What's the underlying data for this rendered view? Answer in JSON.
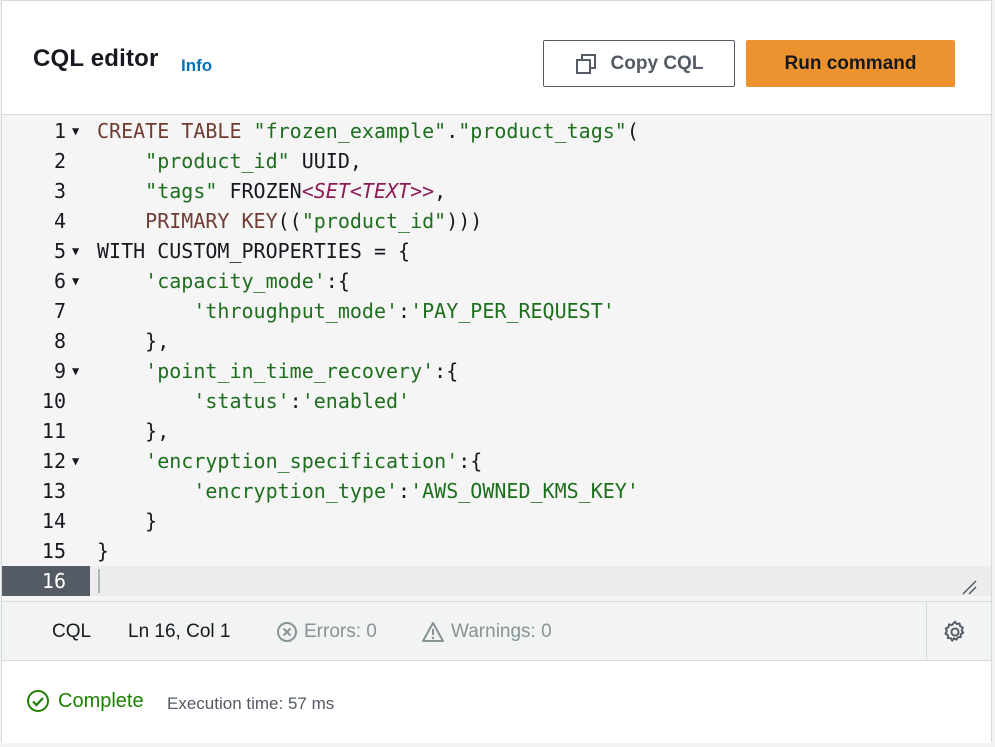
{
  "header": {
    "title": "CQL editor",
    "info_link": "Info",
    "copy_button": "Copy CQL",
    "run_button": "Run command"
  },
  "editor": {
    "active_line": 16,
    "fold_lines": [
      1,
      5,
      6,
      9,
      12
    ],
    "lines": [
      {
        "n": "1",
        "segments": [
          {
            "t": "CREATE TABLE ",
            "c": "kw"
          },
          {
            "t": "\"frozen_example\"",
            "c": "str"
          },
          {
            "t": ".",
            "c": ""
          },
          {
            "t": "\"product_tags\"",
            "c": "str"
          },
          {
            "t": "(",
            "c": ""
          }
        ]
      },
      {
        "n": "2",
        "segments": [
          {
            "t": "    ",
            "c": ""
          },
          {
            "t": "\"product_id\"",
            "c": "str"
          },
          {
            "t": " UUID,",
            "c": ""
          }
        ]
      },
      {
        "n": "3",
        "segments": [
          {
            "t": "    ",
            "c": ""
          },
          {
            "t": "\"tags\"",
            "c": "str"
          },
          {
            "t": " FROZEN",
            "c": ""
          },
          {
            "t": "<SET<TEXT>>",
            "c": "typ"
          },
          {
            "t": ",",
            "c": ""
          }
        ]
      },
      {
        "n": "4",
        "segments": [
          {
            "t": "    ",
            "c": ""
          },
          {
            "t": "PRIMARY KEY",
            "c": "kw"
          },
          {
            "t": "((",
            "c": ""
          },
          {
            "t": "\"product_id\"",
            "c": "str"
          },
          {
            "t": ")))",
            "c": ""
          }
        ]
      },
      {
        "n": "5",
        "segments": [
          {
            "t": "WITH CUSTOM_PROPERTIES = {",
            "c": ""
          }
        ]
      },
      {
        "n": "6",
        "segments": [
          {
            "t": "    ",
            "c": ""
          },
          {
            "t": "'capacity_mode'",
            "c": "str"
          },
          {
            "t": ":{",
            "c": ""
          }
        ]
      },
      {
        "n": "7",
        "segments": [
          {
            "t": "        ",
            "c": ""
          },
          {
            "t": "'throughput_mode'",
            "c": "str"
          },
          {
            "t": ":",
            "c": ""
          },
          {
            "t": "'PAY_PER_REQUEST'",
            "c": "str"
          }
        ]
      },
      {
        "n": "8",
        "segments": [
          {
            "t": "    },",
            "c": ""
          }
        ]
      },
      {
        "n": "9",
        "segments": [
          {
            "t": "    ",
            "c": ""
          },
          {
            "t": "'point_in_time_recovery'",
            "c": "str"
          },
          {
            "t": ":{",
            "c": ""
          }
        ]
      },
      {
        "n": "10",
        "segments": [
          {
            "t": "        ",
            "c": ""
          },
          {
            "t": "'status'",
            "c": "str"
          },
          {
            "t": ":",
            "c": ""
          },
          {
            "t": "'enabled'",
            "c": "str"
          }
        ]
      },
      {
        "n": "11",
        "segments": [
          {
            "t": "    },",
            "c": ""
          }
        ]
      },
      {
        "n": "12",
        "segments": [
          {
            "t": "    ",
            "c": ""
          },
          {
            "t": "'encryption_specification'",
            "c": "str"
          },
          {
            "t": ":{",
            "c": ""
          }
        ]
      },
      {
        "n": "13",
        "segments": [
          {
            "t": "        ",
            "c": ""
          },
          {
            "t": "'encryption_type'",
            "c": "str"
          },
          {
            "t": ":",
            "c": ""
          },
          {
            "t": "'AWS_OWNED_KMS_KEY'",
            "c": "str"
          }
        ]
      },
      {
        "n": "14",
        "segments": [
          {
            "t": "    }",
            "c": ""
          }
        ]
      },
      {
        "n": "15",
        "segments": [
          {
            "t": "}",
            "c": ""
          }
        ]
      },
      {
        "n": "16",
        "segments": []
      }
    ]
  },
  "status_bar": {
    "language": "CQL",
    "position": "Ln 16, Col 1",
    "errors": "Errors: 0",
    "warnings": "Warnings: 0"
  },
  "result": {
    "status": "Complete",
    "execution_time": "Execution time: 57 ms"
  },
  "colors": {
    "primary_button": "#ec9330",
    "link": "#0073bb",
    "success": "#1d8102",
    "keyword": "#703d33",
    "string": "#1d6f1e",
    "type": "#8c1c57"
  }
}
